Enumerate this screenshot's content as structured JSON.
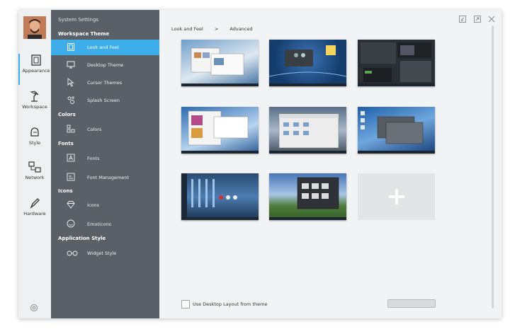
{
  "categories": [
    {
      "label": "Appearance",
      "icon": "paint-frame-icon",
      "active": true
    },
    {
      "label": "Workspace",
      "icon": "desk-lamp-icon",
      "active": false
    },
    {
      "label": "Style",
      "icon": "helmet-icon",
      "active": false
    },
    {
      "label": "Network",
      "icon": "network-icon",
      "active": false
    },
    {
      "label": "Hardware",
      "icon": "pen-icon",
      "active": false
    }
  ],
  "sidebar": {
    "title": "System Settings",
    "sections": {
      "workspace_theme": "Workspace Theme",
      "colors": "Colors",
      "fonts": "Fonts",
      "icons": "Icons",
      "application_style": "Application Style"
    },
    "items": {
      "look_and_feel": "Look and Feel",
      "desktop_theme": "Desktop Theme",
      "cursor_themes": "Cursor Themes",
      "splash_screen": "Splash Screen",
      "colors": "Colors",
      "fonts": "Fonts",
      "font_management": "Font Management",
      "icons": "Icons",
      "emoticons": "Emoticons",
      "widget_style": "Widget Style"
    }
  },
  "breadcrumb": {
    "first": "Look and Feel",
    "separator": ">",
    "second": "Advanced"
  },
  "footer": {
    "checkbox_label": "Use Desktop Layout from theme",
    "checked": false
  },
  "colors": {
    "accent": "#3daee9",
    "sidebar_bg": "#5a6068"
  }
}
